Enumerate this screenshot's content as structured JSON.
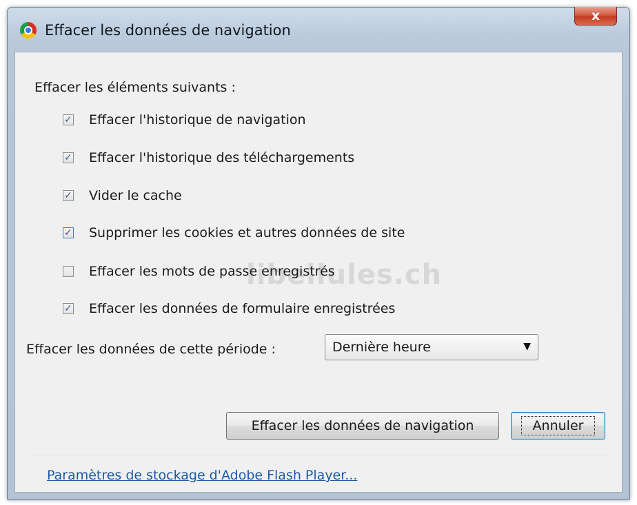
{
  "window": {
    "title": "Effacer les données de navigation",
    "close_label": "x"
  },
  "section_label": "Effacer les éléments suivants :",
  "options": [
    {
      "label": "Effacer l'historique de navigation",
      "checked": true
    },
    {
      "label": "Effacer l'historique des téléchargements",
      "checked": true
    },
    {
      "label": "Vider le cache",
      "checked": true
    },
    {
      "label": "Supprimer les cookies et autres données de site",
      "checked": true
    },
    {
      "label": "Effacer les mots de passe enregistrés",
      "checked": false
    },
    {
      "label": "Effacer les données de formulaire enregistrées",
      "checked": true
    }
  ],
  "period": {
    "label": "Effacer les données de cette période :",
    "selected": "Dernière heure"
  },
  "buttons": {
    "clear": "Effacer les données de navigation",
    "cancel": "Annuler"
  },
  "flash_link": "Paramètres de stockage d'Adobe Flash Player...",
  "watermark": "libellules.ch"
}
